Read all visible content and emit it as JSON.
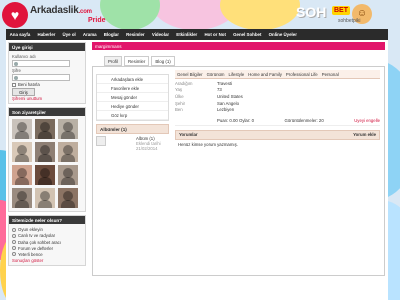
{
  "header": {
    "logo_text": "Arkadaslik",
    "logo_dotcom": ".com",
    "logo_sub": "Pride",
    "chat_banner": {
      "big": "SOH",
      "badge": "BET",
      "small": "sohbetpiki"
    }
  },
  "nav": [
    "Ana sayfa",
    "Haberler",
    "Üye ol",
    "Arama",
    "Bloglar",
    "Resimler",
    "Videolar",
    "Etkinlikler",
    "Hot or Not",
    "Genel Sohbet",
    "Online Üyeler"
  ],
  "login": {
    "title": "Üye girişi",
    "username_label": "Kullanıcı adı",
    "password_label": "Şifre",
    "remember_label": "Beni hatırla",
    "login_button": "Giriş",
    "forgot_link": "Şifremi unuttum"
  },
  "recent_members": {
    "title": "Son ziyaretçiler",
    "colors": [
      "#c9c2bb",
      "#7a6b5d",
      "#b8b0a5",
      "#d9c9b8",
      "#8e7f74",
      "#bfae9e",
      "#cfa38f",
      "#6b4b3c",
      "#a8998c",
      "#9a8c80",
      "#d2c3b2",
      "#8c7464"
    ]
  },
  "poll": {
    "title": "Sitemizde neler olsun?",
    "options": [
      "Oyun ekleyin",
      "Canlı tv ve radyolar",
      "Daha çok sohbet aracı",
      "Forum ve defterler",
      "Yeterli bence"
    ],
    "results_link": "Sonuçları göster"
  },
  "main": {
    "title": "margimmans",
    "tabs": [
      "Profil",
      "Resimler",
      "Blog (1)"
    ],
    "actions": [
      "Arkadaşlara ekle",
      "Favorilere ekle",
      "Mesaj gönder",
      "Hediye gönder",
      "Göz kırp"
    ],
    "albums": {
      "header": "Albümler (1)",
      "album_name": "Albüm (1)",
      "meta1": "Eklendi tarihi",
      "meta2": "21/02/2014"
    },
    "info_tabs": [
      "Genel Bilgiler",
      "Görünüm",
      "Lifestyle",
      "Home and Family",
      "Professional Life",
      "Personal"
    ],
    "info": [
      {
        "key": "Aradığım",
        "val": "Travesti"
      },
      {
        "key": "Yaş",
        "val": "73"
      },
      {
        "key": "Ülke",
        "val": "United States"
      },
      {
        "key": "Şehir",
        "val": "San Angelo"
      },
      {
        "key": "Ben",
        "val": "Lezbiyen"
      }
    ],
    "stats": {
      "score": "Puan: 0.00 Oylar: 0",
      "views": "Görüntülenmeler: 20",
      "report": "Uyeyi engelle"
    },
    "comments": {
      "header": "Yorumlar",
      "add": "Yorum ekle",
      "empty": "Henüz kimse yorum yazmamış."
    }
  }
}
